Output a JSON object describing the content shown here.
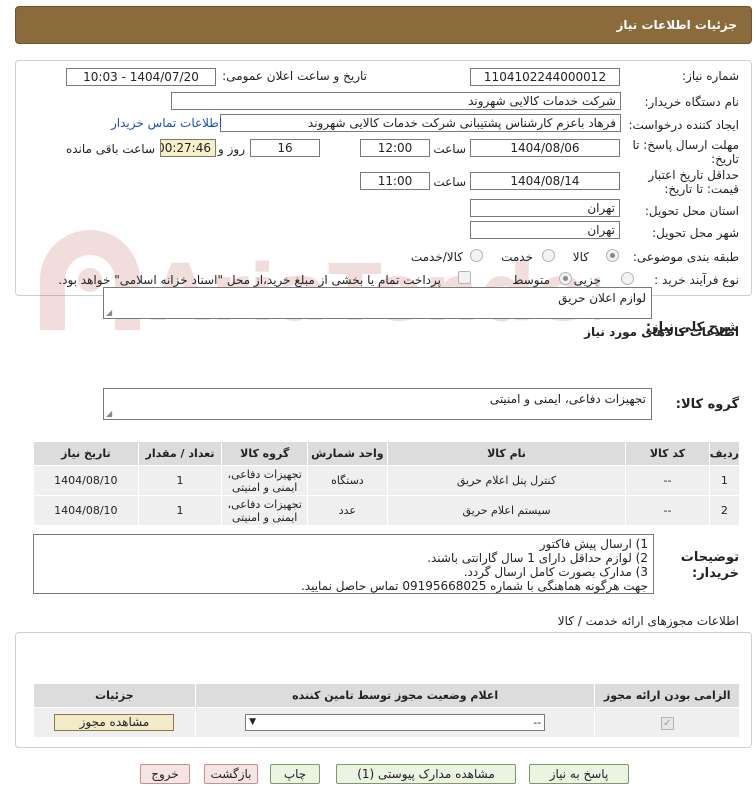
{
  "header": {
    "title": "جزئیات اطلاعات نیاز"
  },
  "form": {
    "need_number_label": "شماره نیاز:",
    "need_number": "1104102244000012",
    "announce_label": "تاریخ و ساعت اعلان عمومی:",
    "announce_value": "1404/07/20 - 10:03",
    "buyer_org_label": "نام دستگاه خریدار:",
    "buyer_org": "شرکت خدمات کالایی شهروند",
    "creator_label": "ایجاد کننده درخواست:",
    "creator": "فرهاد باعزم کارشناس پشتیبانی شرکت خدمات کالایی شهروند",
    "contact_link": "اطلاعات تماس خریدار",
    "reply_deadline_label_1": "مهلت ارسال پاسخ: تا",
    "reply_deadline_label_2": "تاریخ:",
    "reply_date": "1404/08/06",
    "time_label": "ساعت",
    "reply_time": "12:00",
    "days": "16",
    "days_label": "روز و",
    "remaining": "00:27:46",
    "remaining_label": "ساعت باقی مانده",
    "validity_label_1": "حداقل تاریخ اعتبار",
    "validity_label_2": "قیمت: تا تاریخ:",
    "validity_date": "1404/08/14",
    "validity_time": "11:00",
    "province_label": "استان محل تحویل:",
    "province": "تهران",
    "city_label": "شهر محل تحویل:",
    "city": "تهران",
    "category_label": "طبقه بندی موضوعی:",
    "category_options": [
      "کالا",
      "خدمت",
      "کالا/خدمت"
    ],
    "process_label": "نوع فرآیند خرید :",
    "process_options": [
      "جزیی",
      "متوسط"
    ],
    "payment_note": "پرداخت تمام یا بخشی از مبلغ خرید،از محل \"اسناد خزانه اسلامی\" خواهد بود."
  },
  "summary": {
    "label": "شرح کلی نیاز:",
    "text": "لوازم اعلان حریق"
  },
  "goods": {
    "section_title": "اطلاعات کالاهای مورد نیاز",
    "group_label": "گروه کالا:",
    "group_value": "تجهیزات دفاعی، ایمنی و امنیتی",
    "columns": [
      "ردیف",
      "کد کالا",
      "نام کالا",
      "واحد شمارش",
      "گروه کالا",
      "تعداد / مقدار",
      "تاریخ نیاز"
    ],
    "rows": [
      {
        "idx": "1",
        "code": "--",
        "name": "کنترل پنل اعلام حریق",
        "unit": "دستگاه",
        "group": "تجهیزات دفاعی، ایمنی و امنیتی",
        "qty": "1",
        "date": "1404/08/10"
      },
      {
        "idx": "2",
        "code": "--",
        "name": "سیستم اعلام حریق",
        "unit": "عدد",
        "group": "تجهیزات دفاعی، ایمنی و امنیتی",
        "qty": "1",
        "date": "1404/08/10"
      }
    ]
  },
  "notes": {
    "label_1": "توضیحات",
    "label_2": "خریدار:",
    "lines": [
      "1) ارسال پیش فاکتور",
      "2) لوازم حداقل دارای 1 سال گارانتی باشند.",
      "3) مدارک بصورت کامل ارسال گردد.",
      "جهت هرگونه هماهنگی با شماره 09195668025 تماس حاصل نمایید."
    ]
  },
  "permits": {
    "section_title": "اطلاعات مجوزهای ارائه خدمت / کالا",
    "columns": [
      "الزامی بودن ارائه مجوز",
      "اعلام وضعیت مجوز توسط تامین کننده",
      "جزئیات"
    ],
    "select_value": "--",
    "view_button": "مشاهده مجوز"
  },
  "actions": {
    "reply": "پاسخ به نیاز",
    "attachments": "مشاهده مدارک پیوستی (1)",
    "print": "چاپ",
    "back": "بازگشت",
    "exit": "خروج"
  },
  "watermark": {
    "text": "AriaTender.neT"
  },
  "colors": {
    "header": "#8b6a3b",
    "link": "#1a4fbf",
    "remaining_bg": "#f6efc8"
  }
}
